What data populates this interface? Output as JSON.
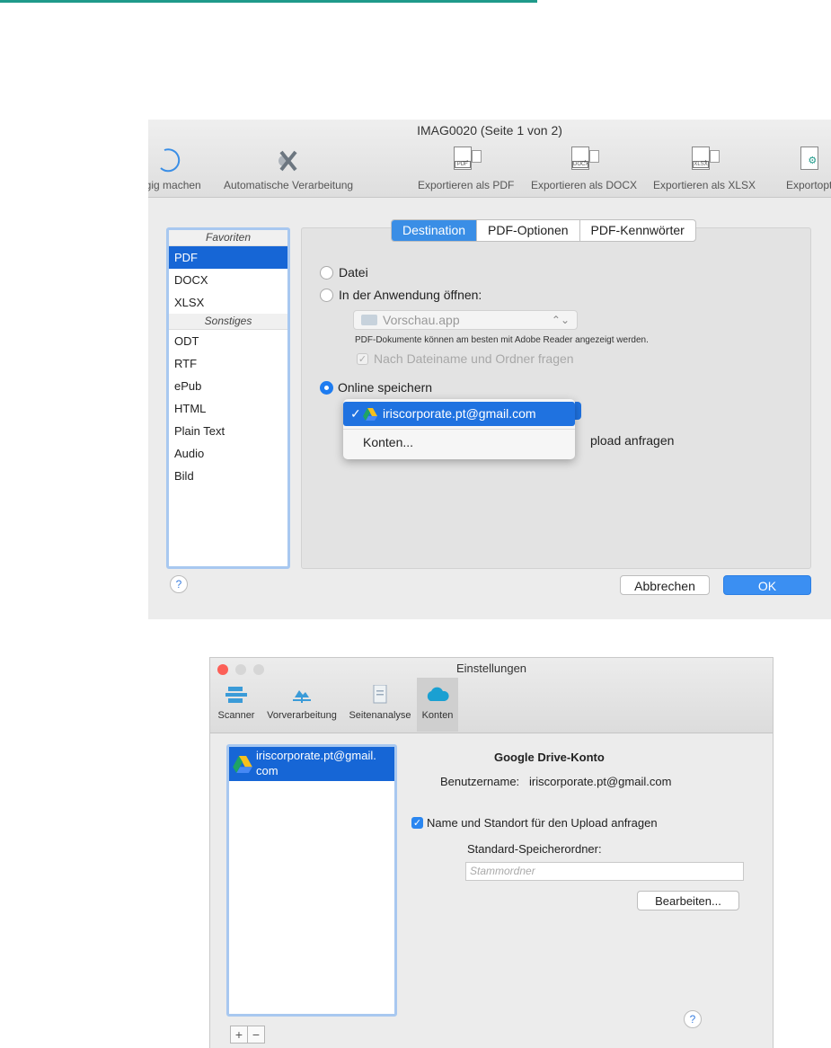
{
  "export_window": {
    "title": "IMAG0020 (Seite 1 von 2)",
    "toolbar": {
      "undo_label": "ngig machen",
      "auto_label": "Automatische Verarbeitung",
      "pdf_label": "Exportieren als PDF",
      "pdf_icon_text": "PDF",
      "docx_label": "Exportieren als DOCX",
      "docx_icon_text": "DOCX",
      "xlsx_label": "Exportieren als XLSX",
      "xlsx_icon_text": "XLSX",
      "options_label": "Exportoptio"
    },
    "sidebar": {
      "favorites_header": "Favoriten",
      "favorites": [
        "PDF",
        "DOCX",
        "XLSX"
      ],
      "other_header": "Sonstiges",
      "other": [
        "ODT",
        "RTF",
        "ePub",
        "HTML",
        "Plain Text",
        "Audio",
        "Bild"
      ]
    },
    "tabs": [
      "Destination",
      "PDF-Optionen",
      "PDF-Kennwörter"
    ],
    "options": {
      "file_label": "Datei",
      "open_in_app_label": "In der Anwendung öffnen:",
      "app_value": "Vorschau.app",
      "hint": "PDF-Dokumente können am besten mit Adobe Reader angezeigt werden.",
      "ask_name_folder_label": "Nach Dateiname und Ordner fragen",
      "online_save_label": "Online speichern",
      "upload_partial": "pload anfragen"
    },
    "dropdown_menu": {
      "checkmark": "✓",
      "selected_account": "iriscorporate.pt@gmail.com",
      "accounts_item": "Konten..."
    },
    "buttons": {
      "help": "?",
      "cancel": "Abbrechen",
      "ok": "OK"
    }
  },
  "settings_window": {
    "title": "Einstellungen",
    "tabs": [
      "Scanner",
      "Vorverarbeitung",
      "Seitenanalyse",
      "Konten"
    ],
    "account_list": {
      "account_line1": "iriscorporate.pt@gmail.",
      "account_line2": "com"
    },
    "add_button": "+",
    "remove_button": "−",
    "detail": {
      "heading": "Google Drive-Konto",
      "username_label": "Benutzername:",
      "username_value": "iriscorporate.pt@gmail.com",
      "upload_checkbox_label": "Name und Standort für den Upload anfragen",
      "default_folder_label": "Standard-Speicherordner:",
      "default_folder_placeholder": "Stammordner",
      "edit_button": "Bearbeiten...",
      "help": "?"
    }
  },
  "colors": {
    "accent": "#1f72e0",
    "selection": "#1666d6",
    "top_line": "#1f9a8a"
  }
}
